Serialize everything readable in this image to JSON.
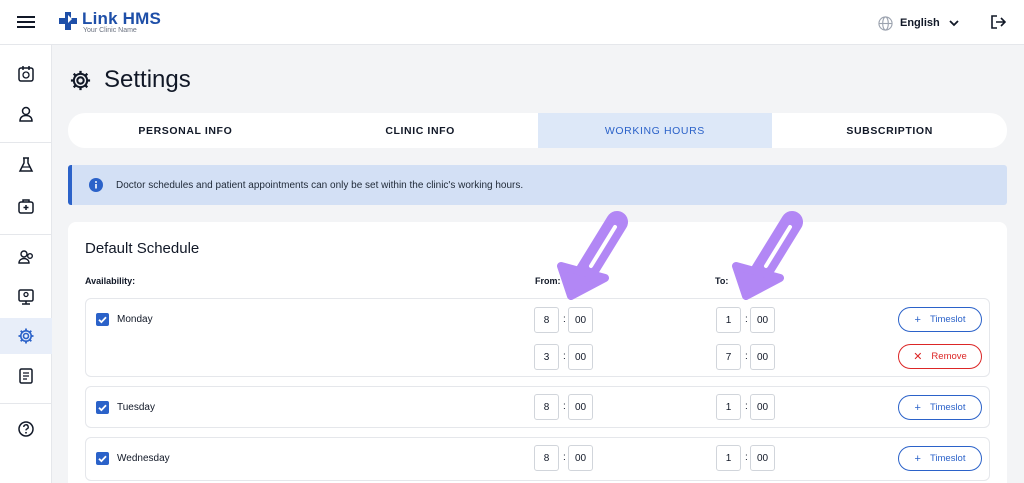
{
  "header": {
    "brand": "Link HMS",
    "tagline": "Your Clinic Name",
    "language": "English"
  },
  "page": {
    "title": "Settings"
  },
  "tabs": [
    {
      "label": "PERSONAL INFO"
    },
    {
      "label": "CLINIC INFO"
    },
    {
      "label": "WORKING HOURS",
      "active": true
    },
    {
      "label": "SUBSCRIPTION"
    }
  ],
  "notice": {
    "text": "Doctor schedules and patient appointments can only be set within the clinic's working hours."
  },
  "schedule": {
    "title": "Default Schedule",
    "availability_label": "Availability:",
    "from_label": "From:",
    "to_label": "To:",
    "timeslot_label": "Timeslot",
    "remove_label": "Remove",
    "separator": ":",
    "days": [
      {
        "name": "Monday",
        "checked": true,
        "slots": [
          {
            "from_h": "8",
            "from_m": "00",
            "to_h": "1",
            "to_m": "00"
          },
          {
            "from_h": "3",
            "from_m": "00",
            "to_h": "7",
            "to_m": "00"
          }
        ]
      },
      {
        "name": "Tuesday",
        "checked": true,
        "slots": [
          {
            "from_h": "8",
            "from_m": "00",
            "to_h": "1",
            "to_m": "00"
          }
        ]
      },
      {
        "name": "Wednesday",
        "checked": true,
        "slots": [
          {
            "from_h": "8",
            "from_m": "00",
            "to_h": "1",
            "to_m": "00"
          }
        ]
      }
    ]
  },
  "colors": {
    "accent": "#2b62c9",
    "danger": "#dc2626",
    "annotation_arrow": "#b287f5"
  }
}
